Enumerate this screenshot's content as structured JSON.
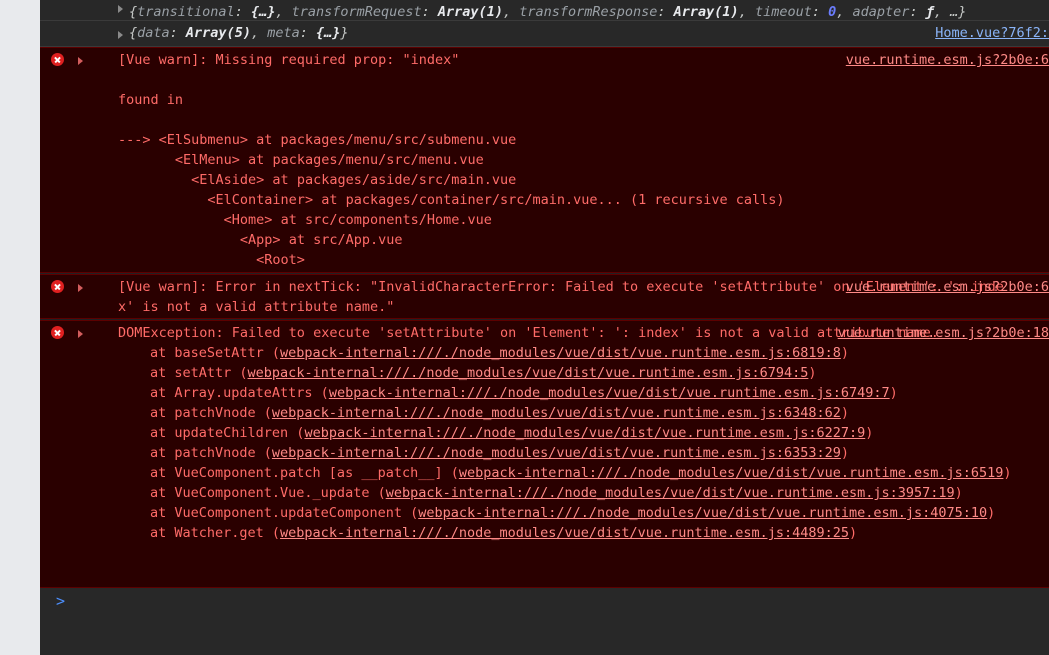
{
  "app": {
    "name": "chrome-devtools-console",
    "panel": "Console"
  },
  "theme": {
    "background": "#202124",
    "log_row_bg": "#282828",
    "error_row_bg": "#2a0000",
    "error_border": "#5c0000",
    "error_text": "#ff6b68",
    "link_blue": "#8ab4f8",
    "link_error": "#ff8a87",
    "gutter": "#e8eaed",
    "prompt_caret": "#4d90fe"
  },
  "messages": [
    {
      "id": "log-axios-config",
      "type": "log",
      "expandable": true,
      "icon": "none",
      "source": "",
      "segments": [
        {
          "t": "{",
          "c": "p"
        },
        {
          "t": "transitional",
          "c": "k"
        },
        {
          "t": ": ",
          "c": "p"
        },
        {
          "t": "{…}",
          "c": "v"
        },
        {
          "t": ", ",
          "c": "p"
        },
        {
          "t": "transformRequest",
          "c": "k"
        },
        {
          "t": ": ",
          "c": "p"
        },
        {
          "t": "Array(1)",
          "c": "v"
        },
        {
          "t": ", ",
          "c": "p"
        },
        {
          "t": "transformResponse",
          "c": "k"
        },
        {
          "t": ": ",
          "c": "p"
        },
        {
          "t": "Array(1)",
          "c": "v"
        },
        {
          "t": ", ",
          "c": "p"
        },
        {
          "t": "timeout",
          "c": "k"
        },
        {
          "t": ": ",
          "c": "p"
        },
        {
          "t": "0",
          "c": "num"
        },
        {
          "t": ", ",
          "c": "p"
        },
        {
          "t": "adapter",
          "c": "k"
        },
        {
          "t": ": ",
          "c": "p"
        },
        {
          "t": "ƒ",
          "c": "v"
        },
        {
          "t": ", …}",
          "c": "p"
        }
      ],
      "plain": "{transitional: {…}, transformRequest: Array(1), transformResponse: Array(1), timeout: 0, adapter: ƒ, …}"
    },
    {
      "id": "log-response-data",
      "type": "log",
      "expandable": true,
      "icon": "none",
      "source": "Home.vue?76f2:",
      "segments": [
        {
          "t": "{",
          "c": "p"
        },
        {
          "t": "data",
          "c": "k"
        },
        {
          "t": ": ",
          "c": "p"
        },
        {
          "t": "Array(5)",
          "c": "v"
        },
        {
          "t": ", ",
          "c": "p"
        },
        {
          "t": "meta",
          "c": "k"
        },
        {
          "t": ": ",
          "c": "p"
        },
        {
          "t": "{…}",
          "c": "v"
        },
        {
          "t": "}",
          "c": "p"
        }
      ],
      "plain": "{data: Array(5), meta: {…}}"
    },
    {
      "id": "err-missing-prop",
      "type": "error",
      "expandable": true,
      "icon": "error-icon",
      "source": "vue.runtime.esm.js?2b0e:6",
      "headline": "[Vue warn]: Missing required prop: \"index\"",
      "body_lines": [
        "",
        "found in",
        "",
        "---> <ElSubmenu> at packages/menu/src/submenu.vue",
        "       <ElMenu> at packages/menu/src/menu.vue",
        "         <ElAside> at packages/aside/src/main.vue",
        "           <ElContainer> at packages/container/src/main.vue... (1 recursive calls)",
        "             <Home> at src/components/Home.vue",
        "               <App> at src/App.vue",
        "                 <Root>"
      ]
    },
    {
      "id": "err-nexttick",
      "type": "error",
      "expandable": true,
      "icon": "error-icon",
      "source": "vue.runtime.esm.js?2b0e:6",
      "headline": "[Vue warn]: Error in nextTick: \"InvalidCharacterError: Failed to execute 'setAttribute' on 'Element': ': index' is not a valid attribute name.\"",
      "body_lines": []
    },
    {
      "id": "err-domexception",
      "type": "error",
      "expandable": true,
      "icon": "error-icon",
      "source": "vue.runtime.esm.js?2b0e:18",
      "headline": "DOMException: Failed to execute 'setAttribute' on 'Element': ': index' is not a valid attribute name.",
      "body_lines": [],
      "stack": [
        {
          "fn": "at baseSetAttr (",
          "url": "webpack-internal:///./node_modules/vue/dist/vue.runtime.esm.js:6819:8",
          "tail": ")"
        },
        {
          "fn": "at setAttr (",
          "url": "webpack-internal:///./node_modules/vue/dist/vue.runtime.esm.js:6794:5",
          "tail": ")"
        },
        {
          "fn": "at Array.updateAttrs (",
          "url": "webpack-internal:///./node_modules/vue/dist/vue.runtime.esm.js:6749:7",
          "tail": ")"
        },
        {
          "fn": "at patchVnode (",
          "url": "webpack-internal:///./node_modules/vue/dist/vue.runtime.esm.js:6348:62",
          "tail": ")"
        },
        {
          "fn": "at updateChildren (",
          "url": "webpack-internal:///./node_modules/vue/dist/vue.runtime.esm.js:6227:9",
          "tail": ")"
        },
        {
          "fn": "at patchVnode (",
          "url": "webpack-internal:///./node_modules/vue/dist/vue.runtime.esm.js:6353:29",
          "tail": ")"
        },
        {
          "fn": "at VueComponent.patch [as __patch__] (",
          "url": "webpack-internal:///./node_modules/vue/dist/vue.runtime.esm.js:6519",
          "tail": ")"
        },
        {
          "fn": "at VueComponent.Vue._update (",
          "url": "webpack-internal:///./node_modules/vue/dist/vue.runtime.esm.js:3957:19",
          "tail": ")"
        },
        {
          "fn": "at VueComponent.updateComponent (",
          "url": "webpack-internal:///./node_modules/vue/dist/vue.runtime.esm.js:4075:10",
          "tail": ")"
        },
        {
          "fn": "at Watcher.get (",
          "url": "webpack-internal:///./node_modules/vue/dist/vue.runtime.esm.js:4489:25",
          "tail": ")"
        }
      ]
    }
  ],
  "prompt": {
    "caret": ">",
    "value": "",
    "placeholder": ""
  }
}
